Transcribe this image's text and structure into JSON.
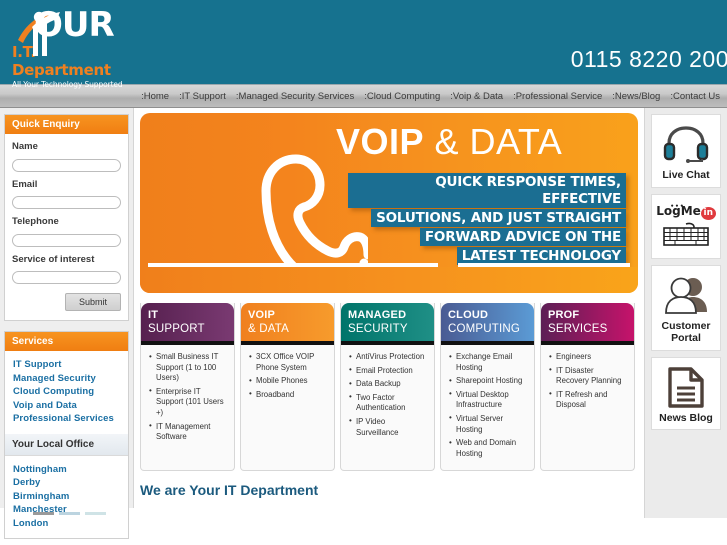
{
  "header": {
    "logo": {
      "name_text": "OUR",
      "department_text": "I.T. Department",
      "tagline": "All Your Technology Supported"
    },
    "phone": "0115 8220 200",
    "brand_teal": "#16728f",
    "brand_orange": "#f0801f"
  },
  "nav": {
    "items": [
      {
        "label": ":Home",
        "name": "home"
      },
      {
        "label": ":IT Support",
        "name": "it-support"
      },
      {
        "label": ":Managed Security Services",
        "name": "managed-security-services"
      },
      {
        "label": ":Cloud Computing",
        "name": "cloud-computing"
      },
      {
        "label": ":Voip & Data",
        "name": "voip-and-data"
      },
      {
        "label": ":Professional Service",
        "name": "professional-service"
      },
      {
        "label": ":News/Blog",
        "name": "news-blog"
      },
      {
        "label": ":Contact Us",
        "name": "contact-us"
      }
    ]
  },
  "sidebar_left": {
    "enquiry": {
      "title": "Quick Enquiry",
      "fields": [
        {
          "label": "Name",
          "value": "",
          "placeholder": ""
        },
        {
          "label": "Email",
          "value": "",
          "placeholder": ""
        },
        {
          "label": "Telephone",
          "value": "",
          "placeholder": ""
        },
        {
          "label": "Service of interest",
          "value": "",
          "placeholder": ""
        }
      ],
      "submit_label": "Submit"
    },
    "services": {
      "title": "Services",
      "links": [
        "IT Support",
        "Managed Security",
        "Cloud Computing",
        "Voip and Data",
        "Professional Services"
      ]
    },
    "local_office": {
      "title": "Your Local Office",
      "links": [
        "Nottingham",
        "Derby",
        "Birmingham",
        "Manchester",
        "London"
      ]
    }
  },
  "banner": {
    "title_bold": "VOIP",
    "title_light": " & DATA",
    "sub_lines": [
      "QUICK RESPONSE TIMES, EFFECTIVE",
      "SOLUTIONS, AND JUST STRAIGHT",
      "FORWARD ADVICE ON THE",
      "LATEST TECHNOLOGY"
    ],
    "icon": "phone-handset-icon",
    "bg_orange_start": "#f07f1b",
    "bg_orange_end": "#f9a41a",
    "sub_bg_teal": "#1b6e92"
  },
  "cards": [
    {
      "title_line1": "IT",
      "title_line2": "SUPPORT",
      "color_start": "#56204f",
      "color_end": "#7a3a72",
      "items": [
        "Small Business IT Support (1 to 100 Users)",
        "Enterprise IT Support (101 Users +)",
        "IT Management Software"
      ]
    },
    {
      "title_line1": "VOIP",
      "title_line2": "& DATA",
      "color_start": "#f0801f",
      "color_end": "#f79b2c",
      "items": [
        "3CX Office VOIP Phone System",
        "Mobile Phones",
        "Broadband"
      ]
    },
    {
      "title_line1": "MANAGED",
      "title_line2": "SECURITY",
      "color_start": "#00746a",
      "color_end": "#1f8f86",
      "items": [
        "AntiVirus Protection",
        "Email Protection",
        "Data Backup",
        "Two Factor Authentication",
        "IP Video Surveillance"
      ]
    },
    {
      "title_line1": "CLOUD",
      "title_line2": "COMPUTING",
      "color_start": "#4a5b93",
      "color_end": "#5b9bd5",
      "items": [
        "Exchange Email Hosting",
        "Sharepoint Hosting",
        "Virtual Desktop Infrastructure",
        "Virtual Server Hosting",
        "Web and Domain Hosting"
      ]
    },
    {
      "title_line1": "PROF",
      "title_line2": "SERVICES",
      "color_start": "#5c1f55",
      "color_end": "#c6136b",
      "items": [
        "Engineers",
        "IT Disaster Recovery Planning",
        "IT Refresh and Disposal"
      ]
    }
  ],
  "bottom": {
    "heading": "We are Your IT Department"
  },
  "sidebar_right": {
    "tiles": [
      {
        "label": "Live Chat",
        "icon": "headset-icon",
        "name": "live-chat"
      },
      {
        "label": "",
        "icon": "logmein-keyboard-icon",
        "name": "logmein"
      },
      {
        "label": "Customer Portal",
        "icon": "user-avatars-icon",
        "name": "customer-portal"
      },
      {
        "label": "News Blog",
        "icon": "document-icon",
        "name": "news-blog"
      }
    ],
    "logmein_wordmark": "LogMe"
  }
}
